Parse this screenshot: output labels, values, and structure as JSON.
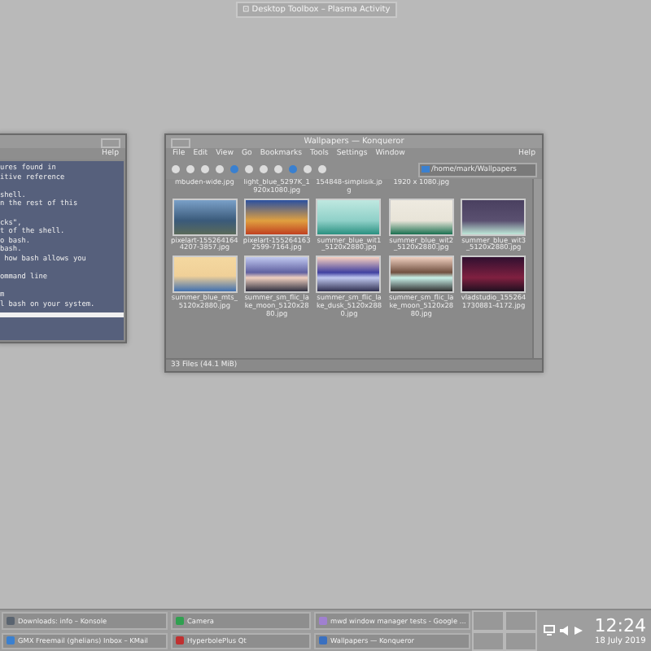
{
  "desktop_label": "⊡ Desktop Toolbox – Plasma Activity",
  "terminal": {
    "menu": [
      "Help"
    ],
    "paragraphs": [
      [
        "ures found in",
        "itive reference"
      ],
      [
        "shell.",
        "n the rest of this"
      ],
      [
        "cks\",",
        "t of the shell.",
        "o bash.",
        "bash.",
        " how bash allows you"
      ],
      [
        "ommand line"
      ],
      [
        "m",
        "l bash on your system."
      ]
    ]
  },
  "konqueror": {
    "title": "Wallpapers — Konqueror",
    "menu": [
      "File",
      "Edit",
      "View",
      "Go",
      "Bookmarks",
      "Tools",
      "Settings",
      "Window"
    ],
    "help": "Help",
    "address": "/home/mark/Wallpapers",
    "top_files": [
      "mbuden-wide.jpg",
      "light_blue_5297K_1920x1080.jpg",
      "154848-simplisik.jpg",
      "1920 x 1080.jpg"
    ],
    "files": [
      {
        "name": "pixelart-1552641644207-3857.jpg"
      },
      {
        "name": "pixelart-1552641632599-7164.jpg"
      },
      {
        "name": "summer_blue_wit1_5120x2880.jpg"
      },
      {
        "name": "summer_blue_wit2_5120x2880.jpg"
      },
      {
        "name": "summer_blue_wit3_5120x2880.jpg"
      },
      {
        "name": "summer_blue_mts_5120x2880.jpg"
      },
      {
        "name": "summer_sm_flic_lake_moon_5120x2880.jpg"
      },
      {
        "name": "summer_sm_flic_lake_dusk_5120x2880.jpg"
      },
      {
        "name": "summer_sm_flic_lake_moon_5120x2880.jpg"
      },
      {
        "name": "vladstudio_1552641730881-4172.jpg"
      }
    ],
    "status": "33 Files (44.1 MiB)"
  },
  "taskbar": {
    "tasks": [
      {
        "label": "Downloads: info – Konsole"
      },
      {
        "label": "GMX Freemail (ghelians) Inbox – KMail"
      },
      {
        "label": "Camera"
      },
      {
        "label": "HyperbolePlus Qt"
      },
      {
        "label": "mwd window manager tests - Google ..."
      },
      {
        "label": "Wallpapers — Konqueror"
      }
    ],
    "clock": "12:24",
    "date": "18 July 2019"
  }
}
